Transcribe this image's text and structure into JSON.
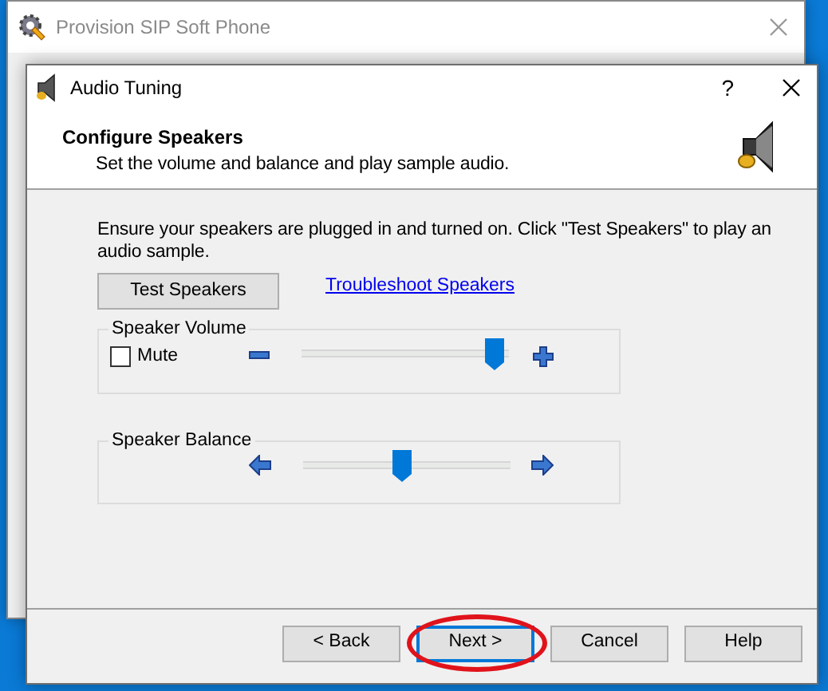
{
  "background_window": {
    "title": "Provision SIP Soft Phone"
  },
  "dialog": {
    "title": "Audio Tuning",
    "help": "?",
    "header": {
      "title": "Configure Speakers",
      "subtitle": "Set the volume and balance and play sample audio."
    },
    "instructions": "Ensure your speakers are plugged in and turned on. Click \"Test Speakers\" to play an audio sample.",
    "test_button": "Test Speakers",
    "troubleshoot_link": "Troubleshoot Speakers",
    "volume": {
      "legend": "Speaker Volume",
      "mute": {
        "label": "Mute",
        "checked": false
      },
      "level": 0.95
    },
    "balance": {
      "legend": "Speaker Balance",
      "level": 0.5
    },
    "buttons": [
      {
        "label": "< Back",
        "focused": false,
        "circled": false
      },
      {
        "label": "Next >",
        "focused": true,
        "circled": true
      },
      {
        "label": "Cancel",
        "focused": false,
        "circled": false
      },
      {
        "label": "Help",
        "focused": false,
        "circled": false
      }
    ]
  }
}
